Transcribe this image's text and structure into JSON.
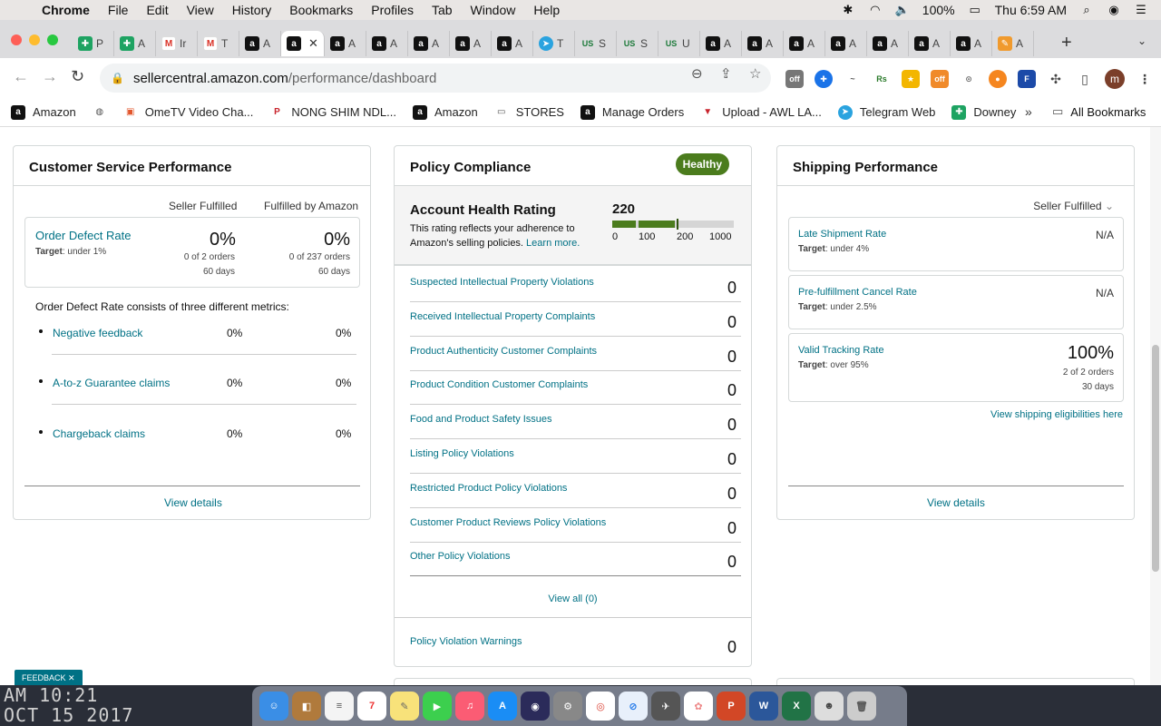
{
  "menubar": {
    "app": "Chrome",
    "items": [
      "File",
      "Edit",
      "View",
      "History",
      "Bookmarks",
      "Profiles",
      "Tab",
      "Window",
      "Help"
    ],
    "battery": "100%",
    "clock": "Thu 6:59 AM"
  },
  "tabs": [
    {
      "icon": "sheets-icon",
      "label": "P"
    },
    {
      "icon": "sheets-icon",
      "label": "A"
    },
    {
      "icon": "gmail-icon",
      "label": "Ir"
    },
    {
      "icon": "gmail-icon",
      "label": "T"
    },
    {
      "icon": "amazon-icon",
      "label": "A"
    },
    {
      "icon": "amazon-icon",
      "label": "",
      "active": true
    },
    {
      "icon": "amazon-icon",
      "label": "A"
    },
    {
      "icon": "amazon-icon",
      "label": "A"
    },
    {
      "icon": "amazon-icon",
      "label": "A"
    },
    {
      "icon": "amazon-icon",
      "label": "A"
    },
    {
      "icon": "amazon-icon",
      "label": "A"
    },
    {
      "icon": "telegram-icon",
      "label": "T"
    },
    {
      "icon": "usfoods-icon",
      "label": "S"
    },
    {
      "icon": "usfoods-icon",
      "label": "S"
    },
    {
      "icon": "usfoods-icon",
      "label": "U"
    },
    {
      "icon": "amazon-icon",
      "label": "A"
    },
    {
      "icon": "amazon-icon",
      "label": "A"
    },
    {
      "icon": "amazon-icon",
      "label": "A"
    },
    {
      "icon": "amazon-icon",
      "label": "A"
    },
    {
      "icon": "amazon-icon",
      "label": "A"
    },
    {
      "icon": "amazon-icon",
      "label": "A"
    },
    {
      "icon": "amazon-icon",
      "label": "A"
    },
    {
      "icon": "misc-icon",
      "label": "A"
    }
  ],
  "address": {
    "host": "sellercentral.amazon.com",
    "path": "/performance/dashboard"
  },
  "bookmarks": [
    {
      "icon": "amazon-icon",
      "label": "Amazon"
    },
    {
      "icon": "globe-icon",
      "label": ""
    },
    {
      "icon": "ometv-icon",
      "label": "OmeTV Video Cha..."
    },
    {
      "icon": "pinterest-icon",
      "label": "NONG SHIM NDL..."
    },
    {
      "icon": "amazon-icon",
      "label": "Amazon"
    },
    {
      "icon": "folder-icon",
      "label": "STORES"
    },
    {
      "icon": "amazon-icon",
      "label": "Manage Orders"
    },
    {
      "icon": "upload-icon",
      "label": "Upload - AWL LA..."
    },
    {
      "icon": "telegram-icon",
      "label": "Telegram Web"
    },
    {
      "icon": "sheets-icon",
      "label": "Downey"
    }
  ],
  "all_bookmarks": "All Bookmarks",
  "customer_service": {
    "title": "Customer Service Performance",
    "col1": "Seller Fulfilled",
    "col2": "Fulfilled by Amazon",
    "odr": {
      "title": "Order Defect Rate",
      "target_label": "Target",
      "target_value": ": under 1%",
      "sf_value": "0%",
      "sf_orders": "0 of 2 orders",
      "sf_days": "60 days",
      "fba_value": "0%",
      "fba_orders": "0 of 237 orders",
      "fba_days": "60 days"
    },
    "intro": "Order Defect Rate consists of three different metrics:",
    "metrics": [
      {
        "name": "Negative feedback",
        "sf": "0%",
        "fba": "0%"
      },
      {
        "name": "A-to-z Guarantee claims",
        "sf": "0%",
        "fba": "0%"
      },
      {
        "name": "Chargeback claims",
        "sf": "0%",
        "fba": "0%"
      }
    ],
    "view_details": "View details"
  },
  "policy": {
    "title": "Policy Compliance",
    "badge": "Healthy",
    "ahr_title": "Account Health Rating",
    "ahr_desc": "This rating reflects your adherence to Amazon's selling policies. ",
    "learn_more": "Learn more.",
    "score": "220",
    "score_ticks": [
      "0",
      "100",
      "200",
      "1000"
    ],
    "violations": [
      {
        "name": "Suspected Intellectual Property Violations",
        "count": "0"
      },
      {
        "name": "Received Intellectual Property Complaints",
        "count": "0"
      },
      {
        "name": "Product Authenticity Customer Complaints",
        "count": "0"
      },
      {
        "name": "Product Condition Customer Complaints",
        "count": "0"
      },
      {
        "name": "Food and Product Safety Issues",
        "count": "0"
      },
      {
        "name": "Listing Policy Violations",
        "count": "0"
      },
      {
        "name": "Restricted Product Policy Violations",
        "count": "0"
      },
      {
        "name": "Customer Product Reviews Policy Violations",
        "count": "0"
      },
      {
        "name": "Other Policy Violations",
        "count": "0"
      }
    ],
    "view_all": "View all (0)",
    "warnings": {
      "name": "Policy Violation Warnings",
      "count": "0"
    }
  },
  "shipping": {
    "title": "Shipping Performance",
    "dropdown": "Seller Fulfilled",
    "metrics": [
      {
        "name": "Late Shipment Rate",
        "target_label": "Target",
        "target_value": ": under 4%",
        "value": "N/A"
      },
      {
        "name": "Pre-fulfillment Cancel Rate",
        "target_label": "Target",
        "target_value": ": under 2.5%",
        "value": "N/A"
      },
      {
        "name": "Valid Tracking Rate",
        "target_label": "Target",
        "target_value": ": over 95%",
        "value": "100%",
        "orders": "2 of 2 orders",
        "days": "30 days"
      }
    ],
    "eligibilities": "View shipping eligibilities here",
    "view_details": "View details"
  },
  "feedback": "FEEDBACK",
  "wallpaper_text": [
    "AM 10:21",
    "OCT 15 2017"
  ],
  "colors": {
    "link": "#007185",
    "healthy": "#4b7c1d",
    "border": "#d5d9d9"
  }
}
